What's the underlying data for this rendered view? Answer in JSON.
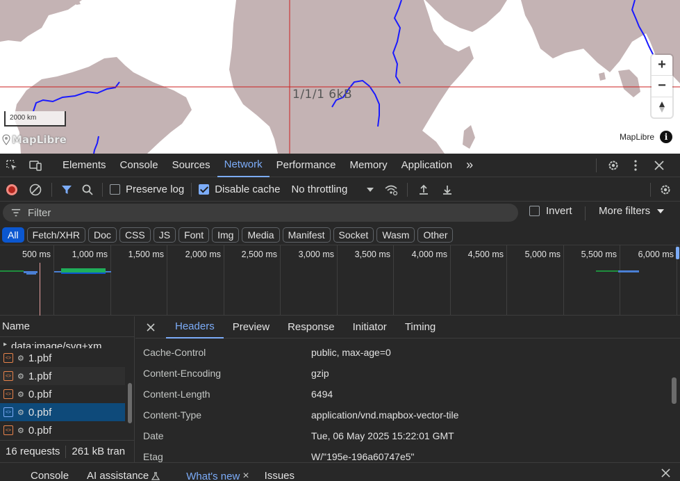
{
  "map": {
    "tile_label": "1/1/1 6kB",
    "scale_label": "2000 km",
    "logo_text": "MapLibre",
    "attribution": "MapLibre",
    "info_icon": "i",
    "zoom_in": "+",
    "zoom_out": "−",
    "compass": "▲",
    "colors": {
      "land": "#c4b3b4",
      "water": "#ffffff",
      "rivers": "#1a1aff",
      "tile_grid": "#cc1f1f"
    }
  },
  "devtools": {
    "tabs": [
      {
        "label": "Elements"
      },
      {
        "label": "Console"
      },
      {
        "label": "Sources"
      },
      {
        "label": "Network"
      },
      {
        "label": "Performance"
      },
      {
        "label": "Memory"
      },
      {
        "label": "Application"
      }
    ],
    "active_tab": "Network",
    "more_tabs": "»",
    "toolbar": {
      "preserve_log": "Preserve log",
      "preserve_log_checked": false,
      "disable_cache": "Disable cache",
      "disable_cache_checked": true,
      "throttling": "No throttling"
    },
    "filter": {
      "placeholder": "Filter",
      "invert": "Invert",
      "more_filters": "More filters"
    },
    "type_filters": [
      "All",
      "Fetch/XHR",
      "Doc",
      "CSS",
      "JS",
      "Font",
      "Img",
      "Media",
      "Manifest",
      "Socket",
      "Wasm",
      "Other"
    ],
    "active_type": "All",
    "timeline": {
      "ticks": [
        "500 ms",
        "1,000 ms",
        "1,500 ms",
        "2,000 ms",
        "2,500 ms",
        "3,000 ms",
        "3,500 ms",
        "4,000 ms",
        "4,500 ms",
        "5,000 ms",
        "5,500 ms",
        "6,000 ms"
      ]
    },
    "request_list": {
      "column_header": "Name",
      "rows": [
        {
          "name": "data:image/svg+xm...",
          "partial": true
        },
        {
          "name": "1.pbf"
        },
        {
          "name": "1.pbf"
        },
        {
          "name": "0.pbf"
        },
        {
          "name": "0.pbf",
          "selected": true
        },
        {
          "name": "0.pbf"
        }
      ],
      "requests": "16 requests",
      "transferred": "261 kB tran"
    },
    "details": {
      "close": "×",
      "tabs": [
        "Headers",
        "Preview",
        "Response",
        "Initiator",
        "Timing"
      ],
      "active_tab": "Headers",
      "headers": [
        {
          "name": "Cache-Control",
          "value": "public, max-age=0"
        },
        {
          "name": "Content-Encoding",
          "value": "gzip"
        },
        {
          "name": "Content-Length",
          "value": "6494"
        },
        {
          "name": "Content-Type",
          "value": "application/vnd.mapbox-vector-tile"
        },
        {
          "name": "Date",
          "value": "Tue, 06 May 2025 15:22:01 GMT"
        },
        {
          "name": "Etag",
          "value": "W/\"195e-196a60747e5\""
        }
      ]
    },
    "drawer": {
      "items": [
        {
          "label": "Console"
        },
        {
          "label": "AI assistance"
        },
        {
          "label": "What's new"
        },
        {
          "label": "Issues"
        }
      ],
      "active": "What's new",
      "close": "×"
    },
    "accent": "#7cacf8"
  }
}
